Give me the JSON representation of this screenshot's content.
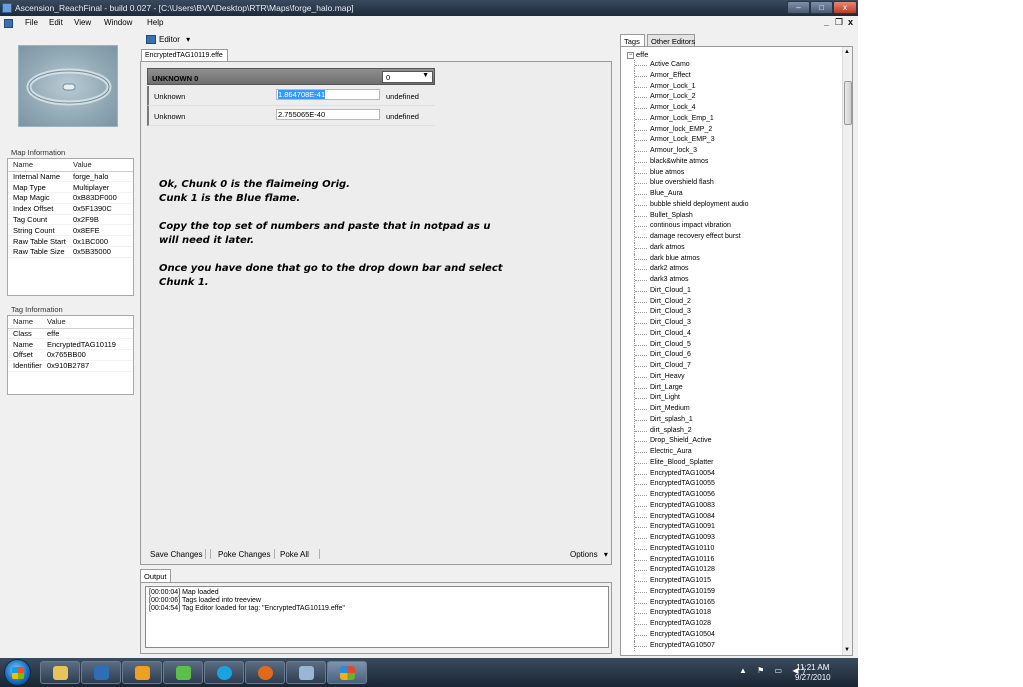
{
  "window": {
    "title": "Ascension_ReachFinal - build 0.027 - [C:\\Users\\BVV\\Desktop\\RTR\\Maps\\forge_halo.map]",
    "controls": {
      "minimize": "–",
      "maximize": "□",
      "close": "x"
    }
  },
  "menu": {
    "items": [
      "File",
      "Edit",
      "View",
      "Window",
      "Help"
    ],
    "mdi_controls": {
      "minimize": "_",
      "restore": "❐",
      "close": "x"
    }
  },
  "map_info": {
    "label": "Map Information",
    "headers": [
      "Name",
      "Value"
    ],
    "rows": [
      [
        "Internal Name",
        "forge_halo"
      ],
      [
        "Map Type",
        "Multiplayer"
      ],
      [
        "Map Magic",
        "0xB83DF000"
      ],
      [
        "Index Offset",
        "0x5F1390C"
      ],
      [
        "Tag Count",
        "0x2F9B"
      ],
      [
        "String Count",
        "0x8EFE"
      ],
      [
        "Raw Table Start",
        "0x1BC000"
      ],
      [
        "Raw Table Size",
        "0x5B35000"
      ]
    ]
  },
  "tag_info": {
    "label": "Tag Information",
    "headers": [
      "Name",
      "Value"
    ],
    "rows": [
      [
        "Class",
        "effe"
      ],
      [
        "Name",
        "EncryptedTAG10119"
      ],
      [
        "Offset",
        "0x765BB00"
      ],
      [
        "Identifier",
        "0x910B2787"
      ]
    ]
  },
  "editor": {
    "toolbar_label": "Editor",
    "toolbar_arrow": "▾",
    "file_tab": "EncryptedTAG10119.effe",
    "chunk": {
      "header": "UNKNOWN 0",
      "selected": "0",
      "arrow": "▼"
    },
    "fields": [
      {
        "name": "Unknown",
        "value": "1.864708E-41",
        "type": "undefined",
        "selected": true
      },
      {
        "name": "Unknown",
        "value": "2.755065E-40",
        "type": "undefined",
        "selected": false
      }
    ],
    "annotation": [
      "Ok, Chunk 0 is the flaimeing Orig.\nCunk 1 is the Blue flame.",
      "Copy the top set of numbers and paste that in notpad as u will need it later.",
      "Once you have done that go to the drop down bar and select Chunk 1."
    ],
    "bottom": {
      "save": "Save Changes",
      "poke": "Poke Changes",
      "poke_all": "Poke All",
      "options": "Options",
      "options_arrow": "▾"
    }
  },
  "output": {
    "tab": "Output",
    "lines": [
      "[00:00:04] Map loaded",
      "[00:00:06] Tags loaded into treeview",
      "[00:04:54] Tag Editor loaded for tag: \"EncryptedTAG10119.effe\""
    ]
  },
  "tree": {
    "tabs": [
      "Tags",
      "Other Editors"
    ],
    "expander": "−",
    "root": "effe",
    "items": [
      "Active Camo",
      "Armor_Effect",
      "Armor_Lock_1",
      "Armor_Lock_2",
      "Armor_Lock_4",
      "Armor_Lock_Emp_1",
      "Armor_lock_EMP_2",
      "Armor_Lock_EMP_3",
      "Armour_lock_3",
      "black&white atmos",
      "blue atmos",
      "blue overshield flash",
      "Blue_Aura",
      "bubble shield deployment audio",
      "Bullet_Splash",
      "continous impact vibration",
      "damage recovery effect burst",
      "dark atmos",
      "dark blue atmos",
      "dark2 atmos",
      "dark3 atmos",
      "Dirt_Cloud_1",
      "Dirt_Cloud_2",
      "Dirt_Cloud_3",
      "Dirt_Cloud_3",
      "Dirt_Cloud_4",
      "Dirt_Cloud_5",
      "Dirt_Cloud_6",
      "Dirt_Cloud_7",
      "Dirt_Heavy",
      "Dirt_Large",
      "Dirt_Light",
      "Dirt_Medium",
      "Dirt_splash_1",
      "dirt_splash_2",
      "Drop_Shield_Active",
      "Electric_Aura",
      "Elite_Blood_Splatter",
      "EncryptedTAG10054",
      "EncryptedTAG10055",
      "EncryptedTAG10056",
      "EncryptedTAG10083",
      "EncryptedTAG10084",
      "EncryptedTAG10091",
      "EncryptedTAG10093",
      "EncryptedTAG10110",
      "EncryptedTAG10116",
      "EncryptedTAG10128",
      "EncryptedTAG1015",
      "EncryptedTAG10159",
      "EncryptedTAG10165",
      "EncryptedTAG1018",
      "EncryptedTAG1028",
      "EncryptedTAG10504",
      "EncryptedTAG10507"
    ],
    "scroll_up": "▲",
    "scroll_down": "▼"
  },
  "taskbar": {
    "time": "11:21 AM",
    "date": "9/27/2010",
    "tray_icons": "▲ ⚑ ▭ ◀)"
  },
  "colors": {
    "titlebar": "#2b3a4d",
    "selection": "#3399ff",
    "chunk_header": "#7f7f7f"
  }
}
